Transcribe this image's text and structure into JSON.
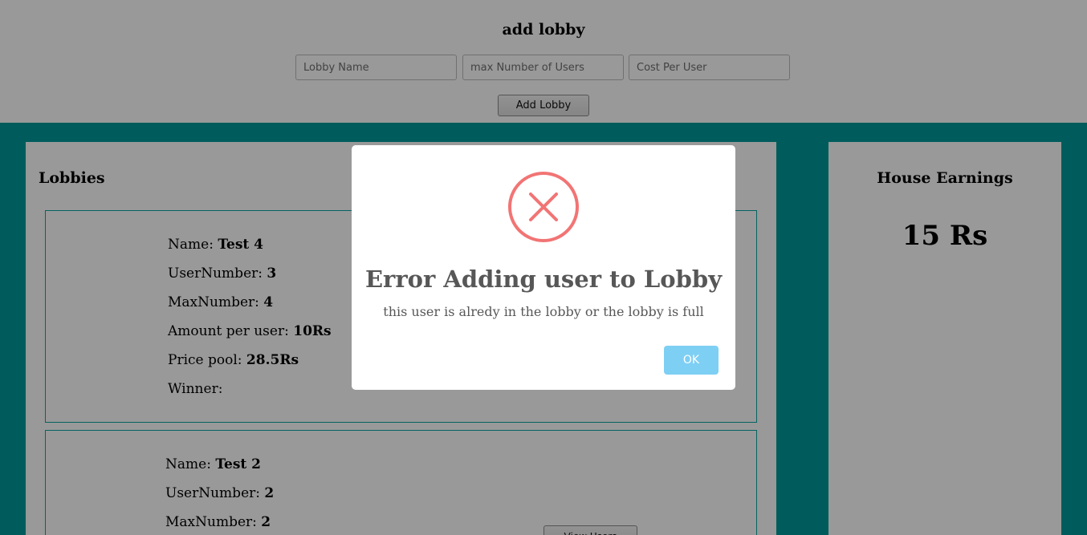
{
  "add_lobby": {
    "title": "add lobby",
    "lobby_name_placeholder": "Lobby Name",
    "max_users_placeholder": "max Number of Users",
    "cost_placeholder": "Cost Per User",
    "button_label": "Add Lobby"
  },
  "lobbies": {
    "title": "Lobbies",
    "labels": {
      "name": "Name: ",
      "user_number": "UserNumber: ",
      "max_number": "MaxNumber: ",
      "amount_per_user": "Amount per user: ",
      "price_pool": "Price pool: ",
      "winner": "Winner:"
    },
    "items": [
      {
        "name": "Test 4",
        "user_number": "3",
        "max_number": "4",
        "amount_per_user": "10Rs",
        "price_pool": "28.5Rs",
        "winner": ""
      },
      {
        "name": "Test 2",
        "user_number": "2",
        "max_number": "2",
        "view_button": "View Users"
      }
    ]
  },
  "house": {
    "title": "House Earnings",
    "amount": "15 Rs"
  },
  "modal": {
    "icon": "error-x-icon",
    "title": "Error Adding user to Lobby",
    "text": "this user is alredy in the lobby or the lobby is full",
    "ok_label": "OK"
  },
  "colors": {
    "page_background": "#019a9a",
    "card_border": "#0aa3a3",
    "error_red": "#f27474",
    "ok_button": "#7ecff4",
    "overlay": "rgba(0,0,0,0.4)"
  }
}
